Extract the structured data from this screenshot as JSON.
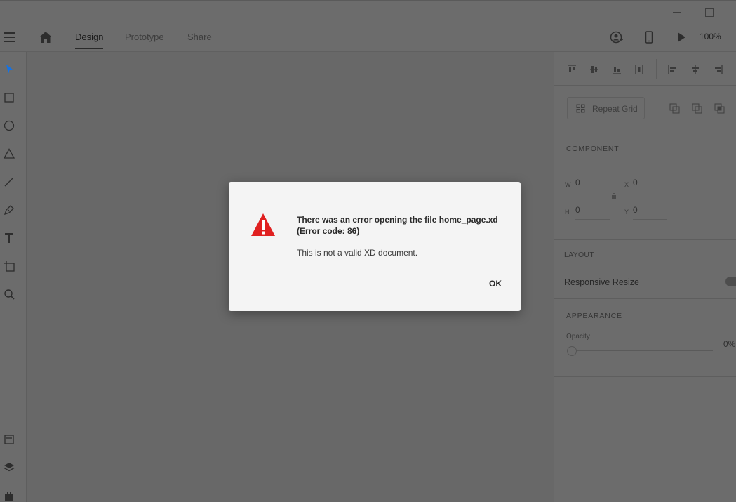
{
  "window": {
    "minimize_icon": "minimize-icon",
    "maximize_icon": "maximize-icon"
  },
  "appbar": {
    "menu_icon": "hamburger-menu-icon",
    "home_icon": "home-icon",
    "tabs": [
      {
        "label": "Design",
        "active": true
      },
      {
        "label": "Prototype",
        "active": false
      },
      {
        "label": "Share",
        "active": false
      }
    ],
    "share_user_icon": "user-share-icon",
    "device_preview_icon": "mobile-device-icon",
    "play_icon": "play-icon",
    "zoom": "100%"
  },
  "toolbar": {
    "tools": [
      "select-icon",
      "rectangle-icon",
      "ellipse-icon",
      "polygon-icon",
      "line-icon",
      "pen-icon",
      "text-icon",
      "artboard-icon",
      "zoom-icon"
    ],
    "bottom_tools": [
      "document-assets-icon",
      "layers-icon",
      "plugins-icon"
    ]
  },
  "panel": {
    "repeat_grid_label": "Repeat Grid",
    "component_title": "COMPONENT",
    "fields": {
      "w_label": "W",
      "w_value": "0",
      "x_label": "X",
      "x_value": "0",
      "h_label": "H",
      "h_value": "0",
      "y_label": "Y",
      "y_value": "0"
    },
    "layout_title": "LAYOUT",
    "responsive_resize_label": "Responsive Resize",
    "appearance_title": "APPEARANCE",
    "opacity_label": "Opacity",
    "opacity_value": "0%"
  },
  "dialog": {
    "icon": "warning-icon",
    "title": "There was an error opening the file home_page.xd (Error code: 86)",
    "message": "This is not a valid XD document.",
    "ok_label": "OK"
  },
  "colors": {
    "warning_red": "#e02020",
    "select_tool_blue": "#1473e6",
    "dialog_bg": "#f4f4f4",
    "overlay_bg": "#696969"
  }
}
